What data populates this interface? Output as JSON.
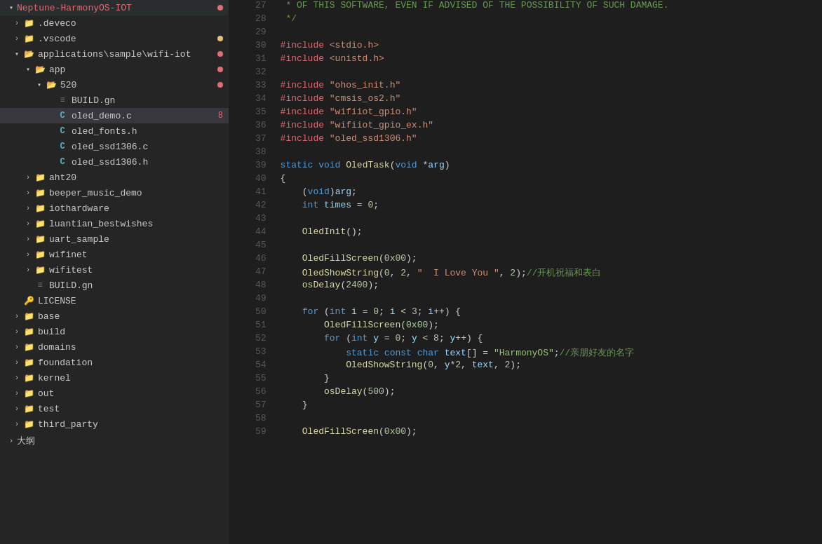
{
  "sidebar": {
    "root": "Neptune-HarmonyOS-IOT",
    "items": [
      {
        "id": "deveco",
        "label": ".deveco",
        "type": "folder",
        "depth": 1,
        "collapsed": true,
        "dot": "none"
      },
      {
        "id": "vscode",
        "label": ".vscode",
        "type": "folder",
        "depth": 1,
        "collapsed": true,
        "dot": "yellow"
      },
      {
        "id": "applications",
        "label": "applications\\sample\\wifi-iot",
        "type": "folder",
        "depth": 1,
        "collapsed": false,
        "dot": "red"
      },
      {
        "id": "app",
        "label": "app",
        "type": "folder",
        "depth": 2,
        "collapsed": false,
        "dot": "red"
      },
      {
        "id": "520",
        "label": "520",
        "type": "folder",
        "depth": 3,
        "collapsed": false,
        "dot": "red"
      },
      {
        "id": "build-gn",
        "label": "BUILD.gn",
        "type": "file-build",
        "depth": 4,
        "dot": "none"
      },
      {
        "id": "oled-demo-c",
        "label": "oled_demo.c",
        "type": "file-c",
        "depth": 4,
        "dot": "none",
        "badge": "8",
        "selected": true
      },
      {
        "id": "oled-fonts-h",
        "label": "oled_fonts.h",
        "type": "file-c",
        "depth": 4,
        "dot": "none"
      },
      {
        "id": "oled-ssd1306-c",
        "label": "oled_ssd1306.c",
        "type": "file-c",
        "depth": 4,
        "dot": "none"
      },
      {
        "id": "oled-ssd1306-h",
        "label": "oled_ssd1306.h",
        "type": "file-c",
        "depth": 4,
        "dot": "none"
      },
      {
        "id": "aht20",
        "label": "aht20",
        "type": "folder",
        "depth": 2,
        "collapsed": true,
        "dot": "none"
      },
      {
        "id": "beeper-music-demo",
        "label": "beeper_music_demo",
        "type": "folder",
        "depth": 2,
        "collapsed": true,
        "dot": "none"
      },
      {
        "id": "iothardware",
        "label": "iothardware",
        "type": "folder",
        "depth": 2,
        "collapsed": true,
        "dot": "none"
      },
      {
        "id": "luantian-bestwishes",
        "label": "luantian_bestwishes",
        "type": "folder",
        "depth": 2,
        "collapsed": true,
        "dot": "none"
      },
      {
        "id": "uart-sample",
        "label": "uart_sample",
        "type": "folder",
        "depth": 2,
        "collapsed": true,
        "dot": "none"
      },
      {
        "id": "wifinet",
        "label": "wifinet",
        "type": "folder",
        "depth": 2,
        "collapsed": true,
        "dot": "none"
      },
      {
        "id": "wifitest",
        "label": "wifitest",
        "type": "folder",
        "depth": 2,
        "collapsed": true,
        "dot": "none"
      },
      {
        "id": "build-gn2",
        "label": "BUILD.gn",
        "type": "file-build",
        "depth": 2,
        "dot": "none"
      },
      {
        "id": "license",
        "label": "LICENSE",
        "type": "file-license",
        "depth": 1,
        "dot": "none"
      },
      {
        "id": "base",
        "label": "base",
        "type": "folder",
        "depth": 1,
        "collapsed": true,
        "dot": "none"
      },
      {
        "id": "build",
        "label": "build",
        "type": "folder",
        "depth": 1,
        "collapsed": true,
        "dot": "none"
      },
      {
        "id": "domains",
        "label": "domains",
        "type": "folder",
        "depth": 1,
        "collapsed": true,
        "dot": "none"
      },
      {
        "id": "foundation",
        "label": "foundation",
        "type": "folder",
        "depth": 1,
        "collapsed": true,
        "dot": "none"
      },
      {
        "id": "kernel",
        "label": "kernel",
        "type": "folder",
        "depth": 1,
        "collapsed": true,
        "dot": "none"
      },
      {
        "id": "out",
        "label": "out",
        "type": "folder",
        "depth": 1,
        "collapsed": true,
        "dot": "none"
      },
      {
        "id": "test",
        "label": "test",
        "type": "folder",
        "depth": 1,
        "collapsed": true,
        "dot": "none"
      },
      {
        "id": "third-party",
        "label": "third_party",
        "type": "folder",
        "depth": 1,
        "collapsed": true,
        "dot": "none"
      },
      {
        "id": "dagang",
        "label": "大纲",
        "type": "outline",
        "depth": 0,
        "dot": "none"
      }
    ]
  },
  "editor": {
    "lines": [
      {
        "num": 27,
        "code": " * OF THIS SOFTWARE, EVEN IF ADVISED OF THE POSSIBILITY OF SUCH DAMAGE.",
        "type": "comment"
      },
      {
        "num": 28,
        "code": " */",
        "type": "comment"
      },
      {
        "num": 29,
        "code": "",
        "type": "empty"
      },
      {
        "num": 30,
        "code": "#include <stdio.h>",
        "type": "include"
      },
      {
        "num": 31,
        "code": "#include <unistd.h>",
        "type": "include"
      },
      {
        "num": 32,
        "code": "",
        "type": "empty"
      },
      {
        "num": 33,
        "code": "#include \"ohos_init.h\"",
        "type": "include-q"
      },
      {
        "num": 34,
        "code": "#include \"cmsis_os2.h\"",
        "type": "include-q"
      },
      {
        "num": 35,
        "code": "#include \"wifiiot_gpio.h\"",
        "type": "include-q"
      },
      {
        "num": 36,
        "code": "#include \"wifiiot_gpio_ex.h\"",
        "type": "include-q"
      },
      {
        "num": 37,
        "code": "#include \"oled_ssd1306.h\"",
        "type": "include-q"
      },
      {
        "num": 38,
        "code": "",
        "type": "empty"
      },
      {
        "num": 39,
        "code": "static void OledTask(void *arg)",
        "type": "funcdef"
      },
      {
        "num": 40,
        "code": "{",
        "type": "brace"
      },
      {
        "num": 41,
        "code": "    (void)arg;",
        "type": "stmt"
      },
      {
        "num": 42,
        "code": "    int times = 0;",
        "type": "stmt"
      },
      {
        "num": 43,
        "code": "",
        "type": "empty"
      },
      {
        "num": 44,
        "code": "    OledInit();",
        "type": "stmt-fn"
      },
      {
        "num": 45,
        "code": "",
        "type": "empty"
      },
      {
        "num": 46,
        "code": "    OledFillScreen(0x00);",
        "type": "stmt-fn"
      },
      {
        "num": 47,
        "code": "    OledShowString(0, 2, \"  I Love You \", 2);//开机祝福和表白",
        "type": "stmt-fn-str"
      },
      {
        "num": 48,
        "code": "    osDelay(2400);",
        "type": "stmt-fn"
      },
      {
        "num": 49,
        "code": "",
        "type": "empty"
      },
      {
        "num": 50,
        "code": "    for (int i = 0; i < 3; i++) {",
        "type": "for"
      },
      {
        "num": 51,
        "code": "        OledFillScreen(0x00);",
        "type": "stmt-fn-indent2"
      },
      {
        "num": 52,
        "code": "        for (int y = 0; y < 8; y++) {",
        "type": "for-indent2"
      },
      {
        "num": 53,
        "code": "            static const char text[] = \"HarmonyOS\";//亲朋好友的名字",
        "type": "stmt-const"
      },
      {
        "num": 54,
        "code": "            OledShowString(0, y*2, text, 2);",
        "type": "stmt-fn-indent3"
      },
      {
        "num": 55,
        "code": "        }",
        "type": "brace-indent2"
      },
      {
        "num": 56,
        "code": "        osDelay(500);",
        "type": "stmt-fn-indent2"
      },
      {
        "num": 57,
        "code": "    }",
        "type": "brace-indent1"
      },
      {
        "num": 58,
        "code": "",
        "type": "empty"
      },
      {
        "num": 59,
        "code": "    OledFillScreen(0x00);",
        "type": "stmt-fn"
      }
    ]
  }
}
